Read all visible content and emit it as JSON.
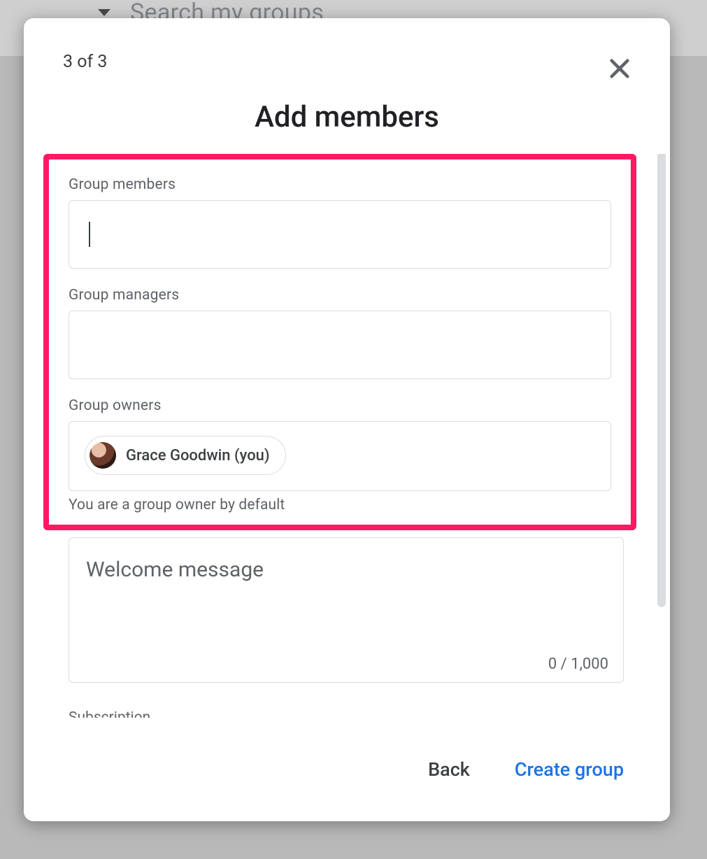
{
  "background": {
    "search_placeholder": "Search my groups"
  },
  "dialog": {
    "step": "3 of 3",
    "title": "Add members",
    "sections": {
      "members": {
        "label": "Group members",
        "value": ""
      },
      "managers": {
        "label": "Group managers",
        "value": ""
      },
      "owners": {
        "label": "Group owners",
        "chips": [
          {
            "name": "Grace Goodwin (you)"
          }
        ],
        "helper": "You are a group owner by default"
      },
      "welcome": {
        "placeholder": "Welcome message",
        "value": "",
        "counter": "0 / 1,000"
      },
      "subscription": {
        "label": "Subscription"
      }
    },
    "footer": {
      "back": "Back",
      "create": "Create group"
    }
  }
}
